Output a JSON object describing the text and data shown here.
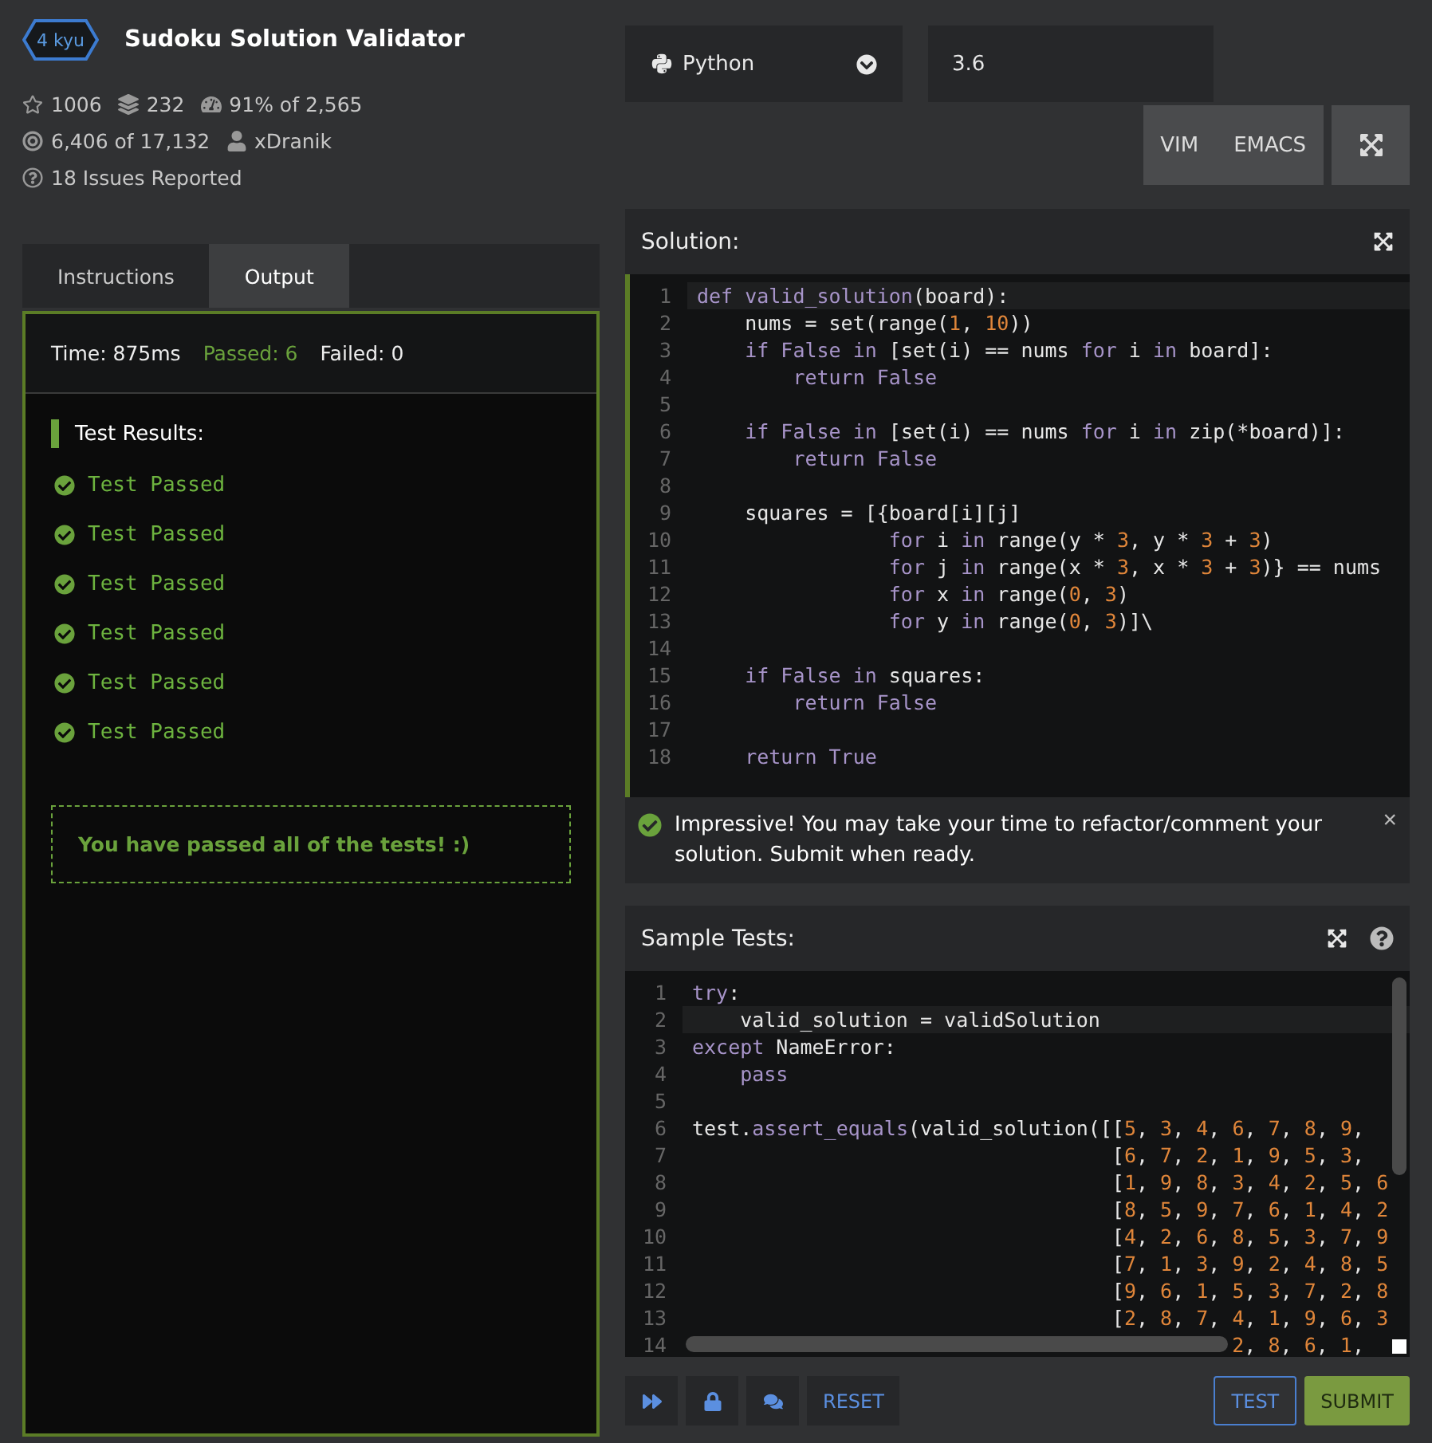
{
  "kata": {
    "rank": "4 kyu",
    "title": "Sudoku Solution Validator",
    "stats": [
      {
        "kind": "stars",
        "text": "1006"
      },
      {
        "kind": "collections",
        "text": "232"
      },
      {
        "kind": "satisfaction",
        "text": "91% of 2,565"
      },
      {
        "kind": "completed",
        "text": "6,406 of 17,132"
      },
      {
        "kind": "author",
        "text": "xDranik"
      },
      {
        "kind": "issues",
        "text": "18 Issues Reported"
      }
    ]
  },
  "language": {
    "name": "Python",
    "version": "3.6"
  },
  "editor_modes": [
    "VIM",
    "EMACS"
  ],
  "tabs": [
    {
      "label": "Instructions",
      "selected": false
    },
    {
      "label": "Output",
      "selected": true
    }
  ],
  "output": {
    "time": "Time: 875ms",
    "passed": "Passed: 6",
    "failed": "Failed: 0",
    "heading": "Test Results:",
    "results": [
      {
        "text": "Test Passed",
        "passed": true
      },
      {
        "text": "Test Passed",
        "passed": true
      },
      {
        "text": "Test Passed",
        "passed": true
      },
      {
        "text": "Test Passed",
        "passed": true
      },
      {
        "text": "Test Passed",
        "passed": true
      },
      {
        "text": "Test Passed",
        "passed": true
      }
    ],
    "message": "You have passed all of the tests! :)"
  },
  "solution": {
    "title": "Solution:",
    "lines": [
      {
        "number": "1",
        "active": true,
        "tokens": [
          {
            "text": "def",
            "kind": "keyword"
          },
          {
            "text": " valid_solution",
            "kind": "keyword"
          },
          {
            "text": "(board):",
            "kind": "plain"
          }
        ]
      },
      {
        "number": "2",
        "active": false,
        "tokens": [
          {
            "text": "    nums = set(range(",
            "kind": "plain"
          },
          {
            "text": "1",
            "kind": "number"
          },
          {
            "text": ", ",
            "kind": "plain"
          },
          {
            "text": "10",
            "kind": "number"
          },
          {
            "text": "))",
            "kind": "plain"
          }
        ]
      },
      {
        "number": "3",
        "active": false,
        "tokens": [
          {
            "text": "    if False in",
            "kind": "keyword"
          },
          {
            "text": " [set(i) == nums ",
            "kind": "plain"
          },
          {
            "text": "for",
            "kind": "keyword"
          },
          {
            "text": " i ",
            "kind": "plain"
          },
          {
            "text": "in",
            "kind": "keyword"
          },
          {
            "text": " board]:",
            "kind": "plain"
          }
        ]
      },
      {
        "number": "4",
        "active": false,
        "tokens": [
          {
            "text": "        return False",
            "kind": "keyword"
          }
        ]
      },
      {
        "number": "5",
        "active": false
      },
      {
        "number": "6",
        "active": false,
        "tokens": [
          {
            "text": "    if False in",
            "kind": "keyword"
          },
          {
            "text": " [set(i) == nums ",
            "kind": "plain"
          },
          {
            "text": "for",
            "kind": "keyword"
          },
          {
            "text": " i ",
            "kind": "plain"
          },
          {
            "text": "in",
            "kind": "keyword"
          },
          {
            "text": " zip(*board)]:",
            "kind": "plain"
          }
        ]
      },
      {
        "number": "7",
        "active": false,
        "tokens": [
          {
            "text": "        return False",
            "kind": "keyword"
          }
        ]
      },
      {
        "number": "8",
        "active": false
      },
      {
        "number": "9",
        "active": false,
        "tokens": [
          {
            "text": "    squares = [{board[i][j]",
            "kind": "plain"
          }
        ]
      },
      {
        "number": "10",
        "active": false,
        "tokens": [
          {
            "text": "                for",
            "kind": "keyword"
          },
          {
            "text": " i ",
            "kind": "plain"
          },
          {
            "text": "in",
            "kind": "keyword"
          },
          {
            "text": " range(y * ",
            "kind": "plain"
          },
          {
            "text": "3",
            "kind": "number"
          },
          {
            "text": ", y * ",
            "kind": "plain"
          },
          {
            "text": "3",
            "kind": "number"
          },
          {
            "text": " + ",
            "kind": "plain"
          },
          {
            "text": "3",
            "kind": "number"
          },
          {
            "text": ")",
            "kind": "plain"
          }
        ]
      },
      {
        "number": "11",
        "active": false,
        "tokens": [
          {
            "text": "                for",
            "kind": "keyword"
          },
          {
            "text": " j ",
            "kind": "plain"
          },
          {
            "text": "in",
            "kind": "keyword"
          },
          {
            "text": " range(x * ",
            "kind": "plain"
          },
          {
            "text": "3",
            "kind": "number"
          },
          {
            "text": ", x * ",
            "kind": "plain"
          },
          {
            "text": "3",
            "kind": "number"
          },
          {
            "text": " + ",
            "kind": "plain"
          },
          {
            "text": "3",
            "kind": "number"
          },
          {
            "text": ")} == nums",
            "kind": "plain"
          }
        ]
      },
      {
        "number": "12",
        "active": false,
        "tokens": [
          {
            "text": "                for",
            "kind": "keyword"
          },
          {
            "text": " x ",
            "kind": "plain"
          },
          {
            "text": "in",
            "kind": "keyword"
          },
          {
            "text": " range(",
            "kind": "plain"
          },
          {
            "text": "0",
            "kind": "number"
          },
          {
            "text": ", ",
            "kind": "plain"
          },
          {
            "text": "3",
            "kind": "number"
          },
          {
            "text": ")",
            "kind": "plain"
          }
        ]
      },
      {
        "number": "13",
        "active": false,
        "tokens": [
          {
            "text": "                for",
            "kind": "keyword"
          },
          {
            "text": " y ",
            "kind": "plain"
          },
          {
            "text": "in",
            "kind": "keyword"
          },
          {
            "text": " range(",
            "kind": "plain"
          },
          {
            "text": "0",
            "kind": "number"
          },
          {
            "text": ", ",
            "kind": "plain"
          },
          {
            "text": "3",
            "kind": "number"
          },
          {
            "text": ")]\\",
            "kind": "plain"
          }
        ]
      },
      {
        "number": "14",
        "active": false
      },
      {
        "number": "15",
        "active": false,
        "tokens": [
          {
            "text": "    if False in",
            "kind": "keyword"
          },
          {
            "text": " squares:",
            "kind": "plain"
          }
        ]
      },
      {
        "number": "16",
        "active": false,
        "tokens": [
          {
            "text": "        return False",
            "kind": "keyword"
          }
        ]
      },
      {
        "number": "17",
        "active": false
      },
      {
        "number": "18",
        "active": false,
        "tokens": [
          {
            "text": "    return True",
            "kind": "keyword"
          }
        ]
      }
    ]
  },
  "feedback": {
    "text": "Impressive! You may take your time to refactor/comment your solution. Submit when ready.",
    "close": "×"
  },
  "sample_tests": {
    "title": "Sample Tests:",
    "lines": [
      {
        "number": "1",
        "active": false,
        "tokens": [
          {
            "text": "try",
            "kind": "keyword"
          },
          {
            "text": ":",
            "kind": "plain"
          }
        ]
      },
      {
        "number": "2",
        "active": true,
        "tokens": [
          {
            "text": "    valid_solution = validSolution",
            "kind": "plain"
          }
        ]
      },
      {
        "number": "3",
        "active": false,
        "tokens": [
          {
            "text": "except",
            "kind": "keyword"
          },
          {
            "text": " NameError:",
            "kind": "plain"
          }
        ]
      },
      {
        "number": "4",
        "active": false,
        "tokens": [
          {
            "text": "    pass",
            "kind": "keyword"
          }
        ]
      },
      {
        "number": "5",
        "active": false
      },
      {
        "number": "6",
        "active": false,
        "tokens": [
          {
            "text": "test.",
            "kind": "plain"
          },
          {
            "text": "assert_equals",
            "kind": "keyword"
          },
          {
            "text": "(valid_solution([[",
            "kind": "plain"
          },
          {
            "text": "5",
            "kind": "number"
          },
          {
            "text": ", ",
            "kind": "plain"
          },
          {
            "text": "3",
            "kind": "number"
          },
          {
            "text": ", ",
            "kind": "plain"
          },
          {
            "text": "4",
            "kind": "number"
          },
          {
            "text": ", ",
            "kind": "plain"
          },
          {
            "text": "6",
            "kind": "number"
          },
          {
            "text": ", ",
            "kind": "plain"
          },
          {
            "text": "7",
            "kind": "number"
          },
          {
            "text": ", ",
            "kind": "plain"
          },
          {
            "text": "8",
            "kind": "number"
          },
          {
            "text": ", ",
            "kind": "plain"
          },
          {
            "text": "9",
            "kind": "number"
          },
          {
            "text": ",",
            "kind": "plain"
          }
        ]
      },
      {
        "number": "7",
        "active": false,
        "tokens": [
          {
            "text": "                                   [",
            "kind": "plain"
          },
          {
            "text": "6",
            "kind": "number"
          },
          {
            "text": ", ",
            "kind": "plain"
          },
          {
            "text": "7",
            "kind": "number"
          },
          {
            "text": ", ",
            "kind": "plain"
          },
          {
            "text": "2",
            "kind": "number"
          },
          {
            "text": ", ",
            "kind": "plain"
          },
          {
            "text": "1",
            "kind": "number"
          },
          {
            "text": ", ",
            "kind": "plain"
          },
          {
            "text": "9",
            "kind": "number"
          },
          {
            "text": ", ",
            "kind": "plain"
          },
          {
            "text": "5",
            "kind": "number"
          },
          {
            "text": ", ",
            "kind": "plain"
          },
          {
            "text": "3",
            "kind": "number"
          },
          {
            "text": ",",
            "kind": "plain"
          }
        ]
      },
      {
        "number": "8",
        "active": false,
        "tokens": [
          {
            "text": "                                   [",
            "kind": "plain"
          },
          {
            "text": "1",
            "kind": "number"
          },
          {
            "text": ", ",
            "kind": "plain"
          },
          {
            "text": "9",
            "kind": "number"
          },
          {
            "text": ", ",
            "kind": "plain"
          },
          {
            "text": "8",
            "kind": "number"
          },
          {
            "text": ", ",
            "kind": "plain"
          },
          {
            "text": "3",
            "kind": "number"
          },
          {
            "text": ", ",
            "kind": "plain"
          },
          {
            "text": "4",
            "kind": "number"
          },
          {
            "text": ", ",
            "kind": "plain"
          },
          {
            "text": "2",
            "kind": "number"
          },
          {
            "text": ", ",
            "kind": "plain"
          },
          {
            "text": "5",
            "kind": "number"
          },
          {
            "text": ", ",
            "kind": "plain"
          },
          {
            "text": "6",
            "kind": "number"
          }
        ]
      },
      {
        "number": "9",
        "active": false,
        "tokens": [
          {
            "text": "                                   [",
            "kind": "plain"
          },
          {
            "text": "8",
            "kind": "number"
          },
          {
            "text": ", ",
            "kind": "plain"
          },
          {
            "text": "5",
            "kind": "number"
          },
          {
            "text": ", ",
            "kind": "plain"
          },
          {
            "text": "9",
            "kind": "number"
          },
          {
            "text": ", ",
            "kind": "plain"
          },
          {
            "text": "7",
            "kind": "number"
          },
          {
            "text": ", ",
            "kind": "plain"
          },
          {
            "text": "6",
            "kind": "number"
          },
          {
            "text": ", ",
            "kind": "plain"
          },
          {
            "text": "1",
            "kind": "number"
          },
          {
            "text": ", ",
            "kind": "plain"
          },
          {
            "text": "4",
            "kind": "number"
          },
          {
            "text": ", ",
            "kind": "plain"
          },
          {
            "text": "2",
            "kind": "number"
          }
        ]
      },
      {
        "number": "10",
        "active": false,
        "tokens": [
          {
            "text": "                                   [",
            "kind": "plain"
          },
          {
            "text": "4",
            "kind": "number"
          },
          {
            "text": ", ",
            "kind": "plain"
          },
          {
            "text": "2",
            "kind": "number"
          },
          {
            "text": ", ",
            "kind": "plain"
          },
          {
            "text": "6",
            "kind": "number"
          },
          {
            "text": ", ",
            "kind": "plain"
          },
          {
            "text": "8",
            "kind": "number"
          },
          {
            "text": ", ",
            "kind": "plain"
          },
          {
            "text": "5",
            "kind": "number"
          },
          {
            "text": ", ",
            "kind": "plain"
          },
          {
            "text": "3",
            "kind": "number"
          },
          {
            "text": ", ",
            "kind": "plain"
          },
          {
            "text": "7",
            "kind": "number"
          },
          {
            "text": ", ",
            "kind": "plain"
          },
          {
            "text": "9",
            "kind": "number"
          }
        ]
      },
      {
        "number": "11",
        "active": false,
        "tokens": [
          {
            "text": "                                   [",
            "kind": "plain"
          },
          {
            "text": "7",
            "kind": "number"
          },
          {
            "text": ", ",
            "kind": "plain"
          },
          {
            "text": "1",
            "kind": "number"
          },
          {
            "text": ", ",
            "kind": "plain"
          },
          {
            "text": "3",
            "kind": "number"
          },
          {
            "text": ", ",
            "kind": "plain"
          },
          {
            "text": "9",
            "kind": "number"
          },
          {
            "text": ", ",
            "kind": "plain"
          },
          {
            "text": "2",
            "kind": "number"
          },
          {
            "text": ", ",
            "kind": "plain"
          },
          {
            "text": "4",
            "kind": "number"
          },
          {
            "text": ", ",
            "kind": "plain"
          },
          {
            "text": "8",
            "kind": "number"
          },
          {
            "text": ", ",
            "kind": "plain"
          },
          {
            "text": "5",
            "kind": "number"
          }
        ]
      },
      {
        "number": "12",
        "active": false,
        "tokens": [
          {
            "text": "                                   [",
            "kind": "plain"
          },
          {
            "text": "9",
            "kind": "number"
          },
          {
            "text": ", ",
            "kind": "plain"
          },
          {
            "text": "6",
            "kind": "number"
          },
          {
            "text": ", ",
            "kind": "plain"
          },
          {
            "text": "1",
            "kind": "number"
          },
          {
            "text": ", ",
            "kind": "plain"
          },
          {
            "text": "5",
            "kind": "number"
          },
          {
            "text": ", ",
            "kind": "plain"
          },
          {
            "text": "3",
            "kind": "number"
          },
          {
            "text": ", ",
            "kind": "plain"
          },
          {
            "text": "7",
            "kind": "number"
          },
          {
            "text": ", ",
            "kind": "plain"
          },
          {
            "text": "2",
            "kind": "number"
          },
          {
            "text": ", ",
            "kind": "plain"
          },
          {
            "text": "8",
            "kind": "number"
          }
        ]
      },
      {
        "number": "13",
        "active": false,
        "tokens": [
          {
            "text": "                                   [",
            "kind": "plain"
          },
          {
            "text": "2",
            "kind": "number"
          },
          {
            "text": ", ",
            "kind": "plain"
          },
          {
            "text": "8",
            "kind": "number"
          },
          {
            "text": ", ",
            "kind": "plain"
          },
          {
            "text": "7",
            "kind": "number"
          },
          {
            "text": ", ",
            "kind": "plain"
          },
          {
            "text": "4",
            "kind": "number"
          },
          {
            "text": ", ",
            "kind": "plain"
          },
          {
            "text": "1",
            "kind": "number"
          },
          {
            "text": ", ",
            "kind": "plain"
          },
          {
            "text": "9",
            "kind": "number"
          },
          {
            "text": ", ",
            "kind": "plain"
          },
          {
            "text": "6",
            "kind": "number"
          },
          {
            "text": ", ",
            "kind": "plain"
          },
          {
            "text": "3",
            "kind": "number"
          }
        ]
      },
      {
        "number": "14",
        "active": false,
        "under_scrollbar": true,
        "tokens": [
          {
            "text": "2",
            "kind": "number"
          },
          {
            "text": ", ",
            "kind": "plain"
          },
          {
            "text": "8",
            "kind": "number"
          },
          {
            "text": ", ",
            "kind": "plain"
          },
          {
            "text": "6",
            "kind": "number"
          },
          {
            "text": ", ",
            "kind": "plain"
          },
          {
            "text": "1",
            "kind": "number"
          },
          {
            "text": ",",
            "kind": "plain"
          }
        ]
      }
    ]
  },
  "actions": [
    {
      "kind": "skip"
    },
    {
      "kind": "unlock"
    },
    {
      "kind": "discuss"
    },
    {
      "kind": "text",
      "label": "RESET"
    }
  ],
  "run": {
    "test": "TEST",
    "submit": "SUBMIT"
  }
}
